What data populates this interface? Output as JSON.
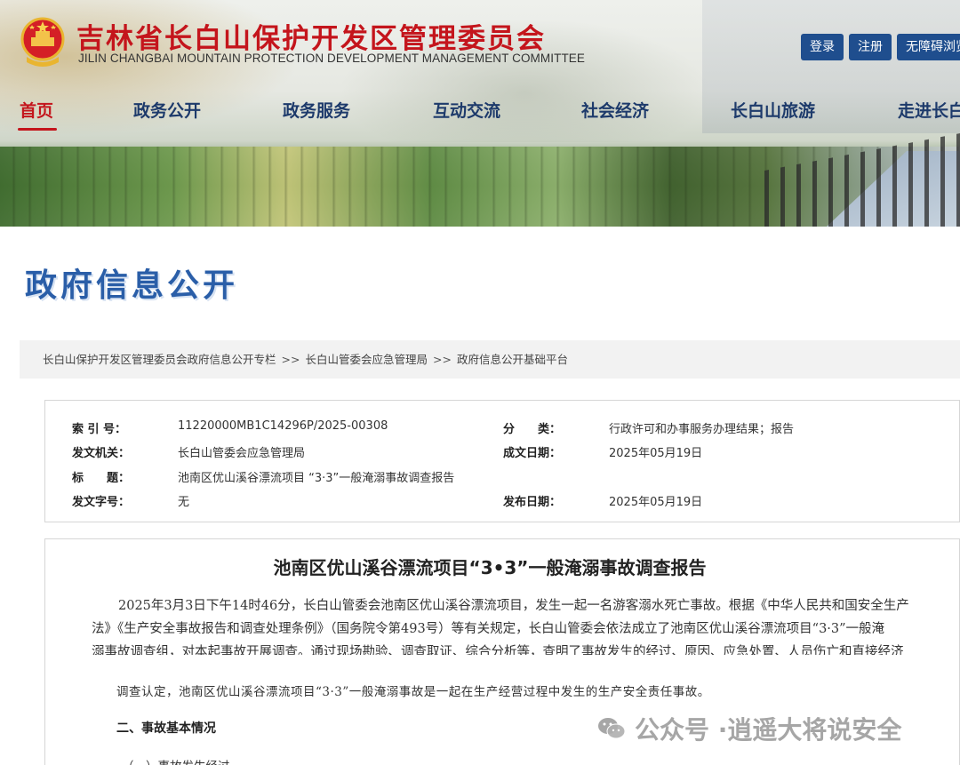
{
  "header": {
    "title": "吉林省长白山保护开发区管理委员会",
    "subtitle": "JILIN CHANGBAI MOUNTAIN PROTECTION DEVELOPMENT MANAGEMENT COMMITTEE",
    "buttons": {
      "login": "登录",
      "register": "注册",
      "accessible": "无障碍浏览"
    },
    "nav": [
      "首页",
      "政务公开",
      "政务服务",
      "互动交流",
      "社会经济",
      "长白山旅游",
      "走进长白山"
    ]
  },
  "section_title": "政府信息公开",
  "breadcrumb": [
    "长白山保护开发区管理委员会政府信息公开专栏",
    "长白山管委会应急管理局",
    "政府信息公开基础平台"
  ],
  "breadcrumb_sep": ">>",
  "meta": {
    "index_label": "索 引 号：",
    "index_value": "11220000MB1C14296P/2025-00308",
    "category_label": "分　　类：",
    "category_value": "行政许可和办事服务办理结果；报告",
    "issuer_label": "发文机关：",
    "issuer_value": "长白山管委会应急管理局",
    "created_label": "成文日期：",
    "created_value": "2025年05月19日",
    "title_label": "标　　题：",
    "title_value": "池南区优山溪谷漂流项目 “3·3”一般淹溺事故调查报告",
    "docno_label": "发文字号：",
    "docno_value": "无",
    "published_label": "发布日期：",
    "published_value": "2025年05月19日"
  },
  "article": {
    "title": "池南区优山溪谷漂流项目“3•3”一般淹溺事故调查报告",
    "para1_line1": "2025年3月3日下午14时46分，长白山管委会池南区优山溪谷漂流项目，发生一起一名游客溺水死亡事故。根据《中华人民共和国安全生产",
    "para1_line2": "法》《生产安全事故报告和调查处理条例》（国务院令第493号）等有关规定，长白山管委会依法成立了池南区优山溪谷漂流项目“3·3”一般淹",
    "para1_line3": "溺事故调查组，对本起事故开展调查。通过现场勘验、调查取证、综合分析等，查明了事故发生的经过、原因、应急处置、人员伤亡和直接经济",
    "conclusion": "调查认定，池南区优山溪谷漂流项目“3·3”一般淹溺事故是一起在生产经营过程中发生的生产安全责任事故。",
    "section2": "二、事故基本情况",
    "section2_1": "（一）事故发生经过"
  },
  "watermark": {
    "prefix": "公众号 · ",
    "name": "逍遥大将说安全"
  },
  "colors": {
    "brand_red": "#c4151c",
    "nav_blue": "#1d3a6b",
    "button_blue": "#1f4e8e",
    "section_blue": "#2a5ea8"
  }
}
